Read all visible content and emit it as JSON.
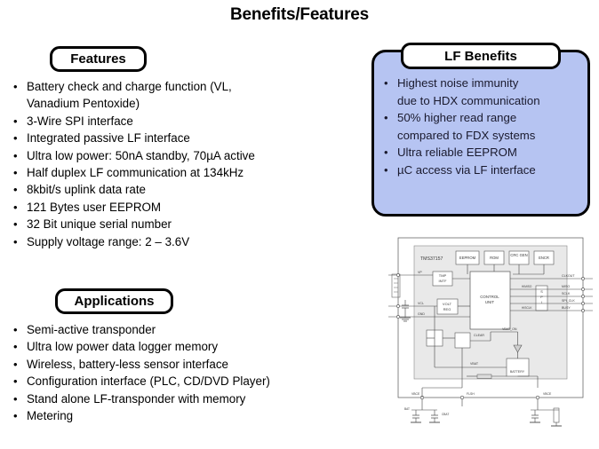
{
  "slide": {
    "title": "Benefits/Features"
  },
  "features": {
    "heading": "Features",
    "items": [
      "Battery check and charge function  (VL,\nVanadium  Pentoxide)",
      "3-Wire SPI interface",
      "Integrated  passive LF interface",
      "Ultra low power: 50nA standby, 70µA active",
      "Half  duplex  LF communication at 134kHz",
      "8kbit/s uplink  data rate",
      "121 Bytes user EEPROM",
      "32 Bit unique  serial number",
      "Supply  voltage range: 2 – 3.6V"
    ]
  },
  "applications": {
    "heading": "Applications",
    "items": [
      "Semi-active transponder",
      "Ultra low power data logger memory",
      "Wireless, battery-less sensor interface",
      "Configuration  interface  (PLC, CD/DVD Player)",
      "Stand alone LF-transponder with memory",
      "Metering"
    ]
  },
  "lf_benefits": {
    "heading": "LF Benefits",
    "panel_color": "#B6C4F2",
    "items": [
      "Highest noise immunity\ndue to HDX  communication",
      "50% higher  read  range\ncompared to FDX systems",
      "Ultra  reliable  EEPROM",
      "µC access via  LF interface"
    ]
  },
  "block_diagram": {
    "chip_label": "TMS37157",
    "blocks": [
      "EEPROM",
      "ROM",
      "CRC GEN",
      "ENCR",
      "TMP INTF",
      "VOLT REG",
      "CONTROL UNIT",
      "SPI",
      "BATTERY"
    ],
    "signals": [
      "VP",
      "VCL",
      "GND",
      "CLKOUT",
      "MISO",
      "SCLK",
      "SPI_CLK",
      "BUSY",
      "CLEAR",
      "VBAT_ON",
      "VBAT",
      "FLSH",
      "VBCE",
      "ANT1",
      "ANT2"
    ]
  },
  "bullet_glyph": "•"
}
